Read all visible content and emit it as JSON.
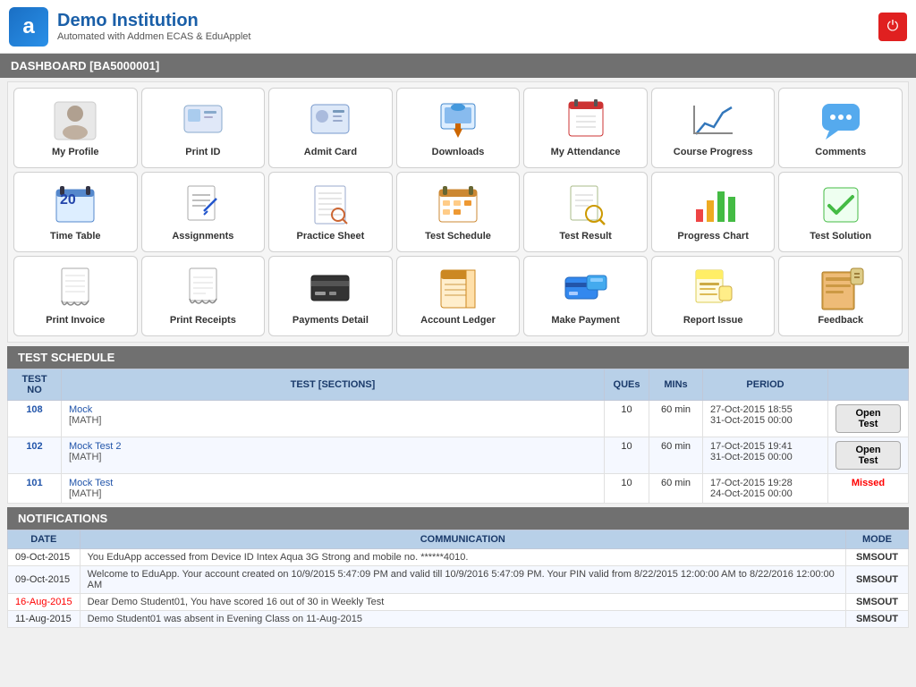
{
  "header": {
    "logo_letter": "a",
    "institution_name": "Demo Institution",
    "subtitle": "Automated with Addmen ECAS & EduApplet",
    "power_icon": "⏻"
  },
  "dashboard_bar": {
    "label": "DASHBOARD [BA5000001]"
  },
  "grid_rows": [
    [
      {
        "id": "my-profile",
        "label": "My Profile",
        "icon": "👤"
      },
      {
        "id": "print-id",
        "label": "Print ID",
        "icon": "🪪"
      },
      {
        "id": "admit-card",
        "label": "Admit Card",
        "icon": "🪪"
      },
      {
        "id": "downloads",
        "label": "Downloads",
        "icon": "🖥️"
      },
      {
        "id": "my-attendance",
        "label": "My Attendance",
        "icon": "📊"
      },
      {
        "id": "course-progress",
        "label": "Course Progress",
        "icon": "📈"
      },
      {
        "id": "comments",
        "label": "Comments",
        "icon": "💬"
      }
    ],
    [
      {
        "id": "time-table",
        "label": "Time Table",
        "icon": "🗓️"
      },
      {
        "id": "assignments",
        "label": "Assignments",
        "icon": "📝"
      },
      {
        "id": "practice-sheet",
        "label": "Practice Sheet",
        "icon": "📄"
      },
      {
        "id": "test-schedule",
        "label": "Test Schedule",
        "icon": "📅"
      },
      {
        "id": "test-result",
        "label": "Test Result",
        "icon": "🔍"
      },
      {
        "id": "progress-chart",
        "label": "Progress Chart",
        "icon": "📊"
      },
      {
        "id": "test-solution",
        "label": "Test Solution",
        "icon": "✅"
      }
    ],
    [
      {
        "id": "print-invoice",
        "label": "Print Invoice",
        "icon": "🧾"
      },
      {
        "id": "print-receipts",
        "label": "Print Receipts",
        "icon": "🧾"
      },
      {
        "id": "payments-detail",
        "label": "Payments Detail",
        "icon": "🖨️"
      },
      {
        "id": "account-ledger",
        "label": "Account Ledger",
        "icon": "📒"
      },
      {
        "id": "make-payment",
        "label": "Make Payment",
        "icon": "💳"
      },
      {
        "id": "report-issue",
        "label": "Report Issue",
        "icon": "📌"
      },
      {
        "id": "feedback",
        "label": "Feedback",
        "icon": "📦"
      }
    ]
  ],
  "test_schedule": {
    "section_title": "TEST SCHEDULE",
    "columns": [
      "TEST NO",
      "TEST [SECTIONS]",
      "QUEs",
      "MINs",
      "PERIOD",
      ""
    ],
    "rows": [
      {
        "test_no": "108",
        "test_name": "Mock",
        "test_section": "[MATH]",
        "ques": "10",
        "mins": "60 min",
        "period": "27-Oct-2015 18:55\n31-Oct-2015 00:00",
        "action": "Open Test",
        "action_type": "button"
      },
      {
        "test_no": "102",
        "test_name": "Mock Test 2",
        "test_section": "[MATH]",
        "ques": "10",
        "mins": "60 min",
        "period": "17-Oct-2015 19:41\n31-Oct-2015 00:00",
        "action": "Open Test",
        "action_type": "button"
      },
      {
        "test_no": "101",
        "test_name": "Mock Test",
        "test_section": "[MATH]",
        "ques": "10",
        "mins": "60 min",
        "period": "17-Oct-2015 19:28\n24-Oct-2015 00:00",
        "action": "Missed",
        "action_type": "label"
      }
    ]
  },
  "notifications": {
    "section_title": "NOTIFICATIONS",
    "columns": [
      "DATE",
      "COMMUNICATION",
      "MODE"
    ],
    "rows": [
      {
        "date": "09-Oct-2015",
        "date_color": "normal",
        "communication": "You EduApp accessed from Device ID Intex Aqua 3G Strong and mobile no. ******4010.",
        "mode": "SMSOUT"
      },
      {
        "date": "09-Oct-2015",
        "date_color": "normal",
        "communication": "Welcome to EduApp. Your account created on 10/9/2015 5:47:09 PM and valid till 10/9/2016 5:47:09 PM. Your PIN valid from 8/22/2015 12:00:00 AM to 8/22/2016 12:00:00 AM",
        "mode": "SMSOUT"
      },
      {
        "date": "16-Aug-2015",
        "date_color": "red",
        "communication": "Dear Demo Student01, You have scored 16 out of 30 in Weekly Test",
        "mode": "SMSOUT"
      },
      {
        "date": "11-Aug-2015",
        "date_color": "normal",
        "communication": "Demo Student01 was absent in Evening Class on 11-Aug-2015",
        "mode": "SMSOUT"
      }
    ]
  }
}
